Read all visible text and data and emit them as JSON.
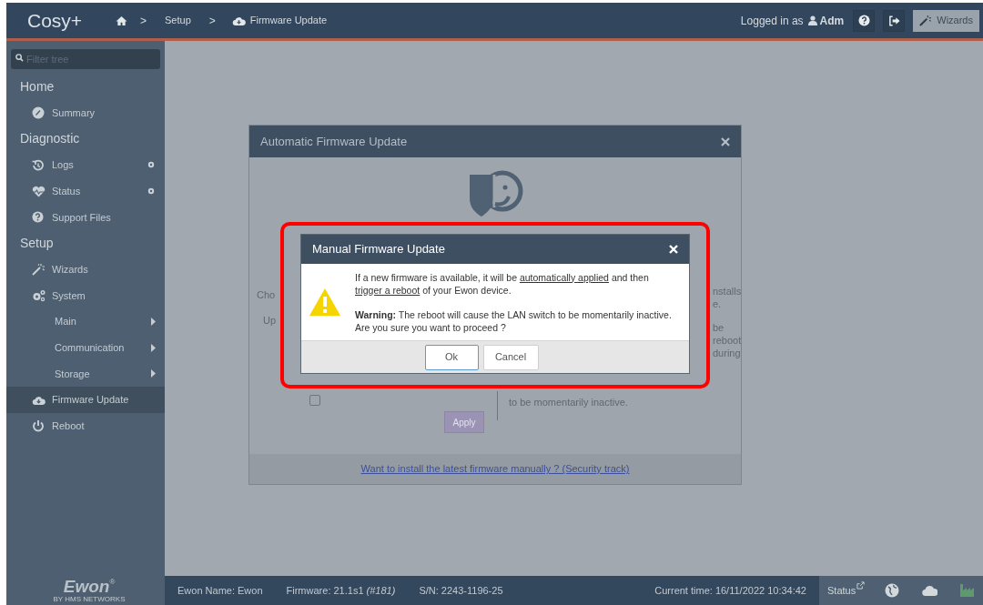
{
  "header": {
    "logo": "Cosy+",
    "breadcrumb": [
      {
        "kind": "home"
      },
      {
        "kind": "separator",
        "label": ">"
      },
      {
        "kind": "link",
        "label": "Setup"
      },
      {
        "kind": "separator",
        "label": ">"
      },
      {
        "kind": "current",
        "label": "Firmware Update"
      }
    ],
    "user": {
      "prefix": "Logged in as",
      "name": "Adm"
    },
    "wizards_button": {
      "label": "Wizards"
    }
  },
  "sidebar": {
    "filter": {
      "placeholder": "Filter tree"
    },
    "sections": [
      {
        "title": "Home",
        "items": [
          {
            "kind": "link",
            "label": "Summary",
            "selected": false
          }
        ]
      },
      {
        "title": "Diagnostic",
        "items": [
          {
            "kind": "link_dot",
            "label": "Logs",
            "selected": false
          },
          {
            "kind": "link_dot",
            "label": "Status",
            "selected": false
          },
          {
            "kind": "link",
            "label": "Support Files",
            "selected": false
          }
        ]
      },
      {
        "title": "Setup",
        "items": [
          {
            "kind": "link",
            "label": "Wizards",
            "selected": false
          },
          {
            "kind": "link",
            "label": "System",
            "selected": false
          },
          {
            "kind": "submenu",
            "label": "Main",
            "selected": false
          },
          {
            "kind": "submenu",
            "label": "Communication",
            "selected": false
          },
          {
            "kind": "submenu",
            "label": "Storage",
            "selected": false
          },
          {
            "kind": "link",
            "label": "Firmware Update",
            "selected": true
          },
          {
            "kind": "link",
            "label": "Reboot",
            "selected": false
          }
        ]
      }
    ],
    "brand": {
      "logo": "Ewon",
      "mark": "®",
      "tagline": "BY HMS NETWORKS"
    }
  },
  "background_dialog": {
    "title": "Automatic Firmware Update",
    "fragments": [
      "Cho",
      "Up",
      "nstalls",
      "e.",
      "be",
      "reboot",
      "during",
      "to be momentarily inactive."
    ],
    "checkbox": {
      "checked": false
    },
    "apply_button": {
      "label": "Apply",
      "disabled": true
    },
    "link": "Want to install the latest firmware manually ? (Security track)"
  },
  "manual_dialog": {
    "title": "Manual Firmware Update",
    "message": [
      {
        "text": "If a new firmware is available, it will be ",
        "underline": false
      },
      {
        "text": "automatically applied",
        "underline": true
      },
      {
        "text": " and then ",
        "underline": false
      },
      {
        "text": "trigger a reboot",
        "underline": true
      },
      {
        "text": " of your Ewon device.",
        "underline": false
      }
    ],
    "warning_lines": [
      "**Warning:** The reboot will cause the LAN switch to be momentarily inactive.",
      "Are you sure you want to proceed ?"
    ],
    "buttons": [
      {
        "label": "Ok",
        "focused": true
      },
      {
        "label": "Cancel",
        "focused": false
      }
    ]
  },
  "status_bar": {
    "items": [
      "Ewon Name: Ewon",
      "Firmware: 21.1s1 *(#181)*",
      "S/N: 2243-1196-25"
    ],
    "time": "Current time: 16/11/2022 10:34:42",
    "status_link": "Status",
    "indicators": [
      {
        "color": "#d3d8dc"
      },
      {
        "color": "#d3d8dc"
      },
      {
        "color": "#5e9a6c"
      }
    ]
  }
}
